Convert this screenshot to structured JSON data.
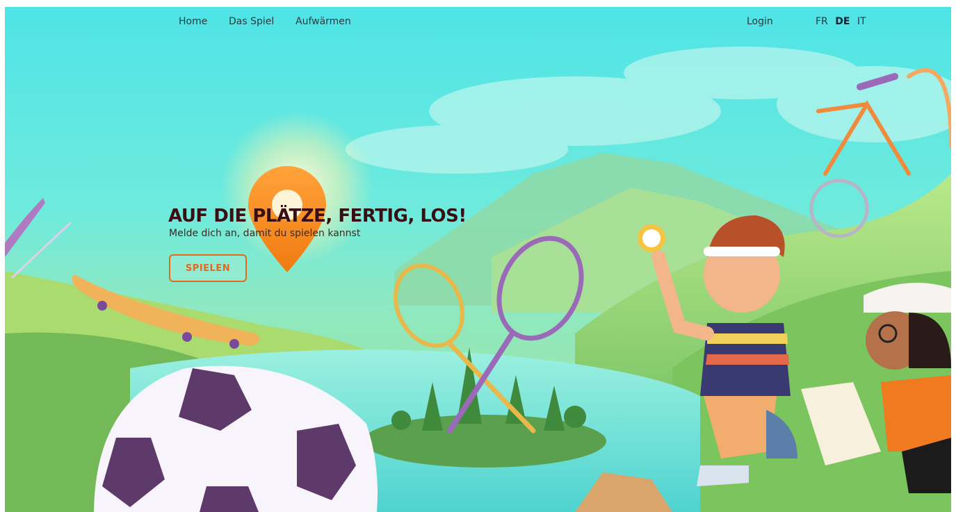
{
  "nav": {
    "home": "Home",
    "das_spiel": "Das Spiel",
    "aufwaermen": "Aufwärmen",
    "login": "Login",
    "languages": [
      {
        "code": "FR",
        "active": false
      },
      {
        "code": "DE",
        "active": true
      },
      {
        "code": "IT",
        "active": false
      }
    ]
  },
  "hero": {
    "title": "AUF DIE PLÄTZE, FERTIG, LOS!",
    "subtitle": "Melde dich an, damit du spielen kannst",
    "cta_label": "SPIELEN"
  },
  "colors": {
    "accent": "#e26a1c",
    "title": "#3a0f14",
    "sky": "#4fe4e6"
  }
}
